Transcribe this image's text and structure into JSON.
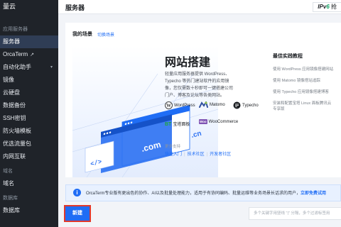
{
  "sidebar": {
    "brand": "量云",
    "groups": {
      "app_server": "应用服务器",
      "domain": "域名",
      "database": "数据库"
    },
    "items": [
      {
        "label": "服务器"
      },
      {
        "label": "OrcaTerm",
        "ext": "↗"
      },
      {
        "label": "自动化助手",
        "chevron": "▾"
      },
      {
        "label": "镜像"
      },
      {
        "label": "云硬盘"
      },
      {
        "label": "数据备份"
      },
      {
        "label": "SSH密钥"
      },
      {
        "label": "防火墙模板"
      },
      {
        "label": "优选流量包"
      },
      {
        "label": "内网互联"
      }
    ],
    "domain_items": [
      {
        "label": "域名"
      }
    ],
    "database_items": [
      {
        "label": "数据库"
      }
    ]
  },
  "header": {
    "title": "服务器",
    "ipv6_prefix": "IPv",
    "ipv6_num": "6",
    "ipv6_suffix": "抢"
  },
  "scene": {
    "title": "我的场景",
    "switch_label": "切换场景",
    "heading": "网站搭建",
    "description": "轻量应用服务器提供 WordPress、Typecho 等热门建站软件的应用镜像，您仅需数十秒即可一键搭建公司门户、博客及论坛等各类网站。",
    "illustration_text_1": ".com",
    "illustration_text_2": ".cn",
    "illustration_code": "</>",
    "apps": [
      {
        "name": "WordPress",
        "icon": "wordpress-icon"
      },
      {
        "name": "Matomo",
        "icon": "matomo-icon"
      },
      {
        "name": "Typecho",
        "icon": "typecho-icon"
      },
      {
        "name": "宝塔面板",
        "icon": "baota-icon",
        "badge": "BT"
      },
      {
        "name": "WooCommerce",
        "icon": "woocommerce-icon",
        "badge": "Woo"
      }
    ],
    "more_label": "更多支持",
    "links": [
      "快速入门",
      "技术社区",
      "开发者社区"
    ]
  },
  "best_practice": {
    "title": "最佳实践教程",
    "items": [
      "使用 WordPress 应用镜像搭建网站",
      "使用 Matomo 镜像搭站追踪",
      "使用 Typecho 应用镜像搭建博客",
      "安装和配置宝塔 Linux 面板腾讯云",
      "专享版"
    ]
  },
  "notice": {
    "text": "OrcaTerm专业版有更出色的协作、AI以及批量处理能力，适用于有协同编码、批量运维等业务场景长话求的用户，",
    "link": "立即免费试用"
  },
  "toolbar": {
    "new_label": "新建",
    "search_placeholder": "多个关键字用竖线 \"|\" 分隔，多个过滤标签用"
  },
  "colors": {
    "accent": "#1f6df5",
    "sidebar_bg": "#1f2329",
    "highlight": "#e1382b"
  }
}
